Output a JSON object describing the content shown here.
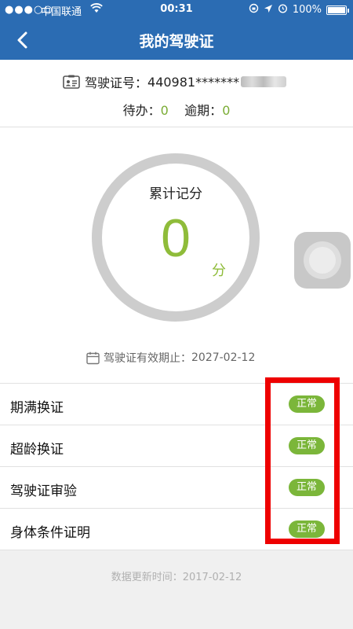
{
  "status_bar": {
    "signal": "●●●○○",
    "carrier": "中国联通",
    "time": "00:31",
    "battery": "100%"
  },
  "nav": {
    "title": "我的驾驶证"
  },
  "license": {
    "label": "驾驶证号：",
    "number": "440981*******"
  },
  "counts": {
    "pending_label": "待办：",
    "pending_value": "0",
    "overdue_label": "逾期：",
    "overdue_value": "0"
  },
  "score": {
    "title": "累计记分",
    "value": "0",
    "unit": "分"
  },
  "validity": {
    "label": "驾驶证有效期止：",
    "date": "2027-02-12"
  },
  "items": [
    {
      "label": "期满换证",
      "status": "正常"
    },
    {
      "label": "超龄换证",
      "status": "正常"
    },
    {
      "label": "驾驶证审验",
      "status": "正常"
    },
    {
      "label": "身体条件证明",
      "status": "正常"
    }
  ],
  "footer": {
    "update_label": "数据更新时间：",
    "update_date": "2017-02-12"
  },
  "colors": {
    "nav_blue": "#2b6cb3",
    "green": "#7bb63a",
    "highlight_red": "#ee0000"
  }
}
